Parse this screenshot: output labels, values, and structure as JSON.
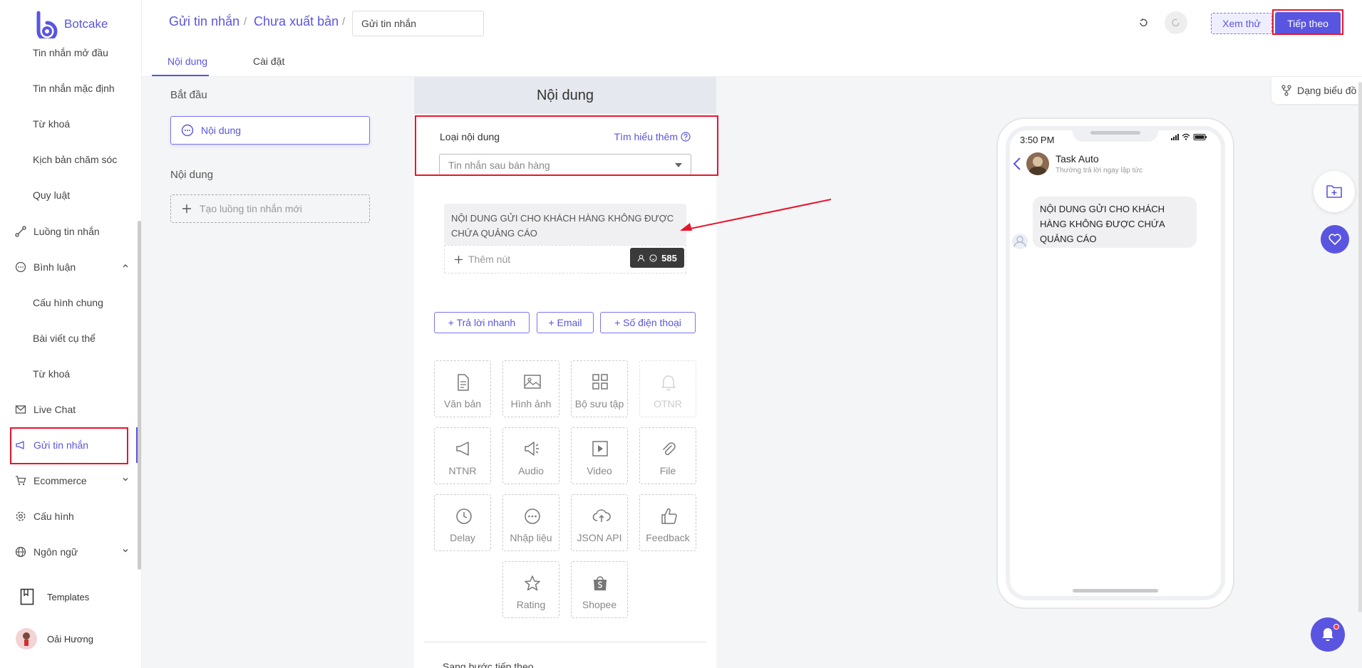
{
  "app": {
    "name": "Botcake"
  },
  "sidebar": {
    "sub_top": [
      "Tin nhắn mở đầu",
      "Tin nhắn mặc định",
      "Từ khoá",
      "Kịch bản chăm sóc",
      "Quy luật"
    ],
    "flow": "Luồng tin nhắn",
    "comment": "Bình luận",
    "comment_sub": [
      "Cấu hình chung",
      "Bài viết cụ thể",
      "Từ khoá"
    ],
    "live_chat": "Live Chat",
    "send_message": "Gửi tin nhắn",
    "ecommerce": "Ecommerce",
    "config": "Cấu hình",
    "language": "Ngôn ngữ",
    "templates": "Templates",
    "user_name": "Oải Hương"
  },
  "header": {
    "crumb1": "Gửi tin nhắn",
    "crumb2": "Chưa xuất bản",
    "crumb_input_value": "Gửi tin nhắn",
    "tab_content": "Nội dung",
    "tab_settings": "Cài đặt",
    "preview": "Xem thử",
    "next": "Tiếp theo"
  },
  "flow": {
    "start_label": "Bắt đầu",
    "start_node": "Nội dung",
    "content_label": "Nội dung",
    "add_flow": "Tạo luồng tin nhắn mới"
  },
  "editor": {
    "title": "Nội dung",
    "content_type_label": "Loại nội dung",
    "learn_more": "Tìm hiểu thêm",
    "content_type_value": "Tin nhắn sau bán hàng",
    "message_text": "NỘI DUNG GỬI CHO KHÁCH HÀNG KHÔNG ĐƯỢC CHỨA QUẢNG CÁO",
    "add_button": "Thêm nút",
    "counter": "585",
    "quick_reply": "+ Trả lời nhanh",
    "email": "+ Email",
    "phone": "+ Số điện thoại",
    "tiles": [
      "Văn bản",
      "Hình ảnh",
      "Bộ sưu tập",
      "OTNR",
      "NTNR",
      "Audio",
      "Video",
      "File",
      "Delay",
      "Nhập liệu",
      "JSON API",
      "Feedback",
      "Rating",
      "Shopee"
    ],
    "next_step": "Sang bước tiếp theo"
  },
  "phone": {
    "time": "3:50 PM",
    "bot_name": "Task Auto",
    "bot_status": "Thường trả lời ngay lập tức",
    "bubble": "NỘI DUNG GỬI CHO KHÁCH HÀNG KHÔNG ĐƯỢC CHỨA QUẢNG CÁO"
  },
  "right": {
    "diagram": "Dạng biểu đồ"
  },
  "colors": {
    "accent": "#5a55e0",
    "highlight": "#e8152d"
  }
}
